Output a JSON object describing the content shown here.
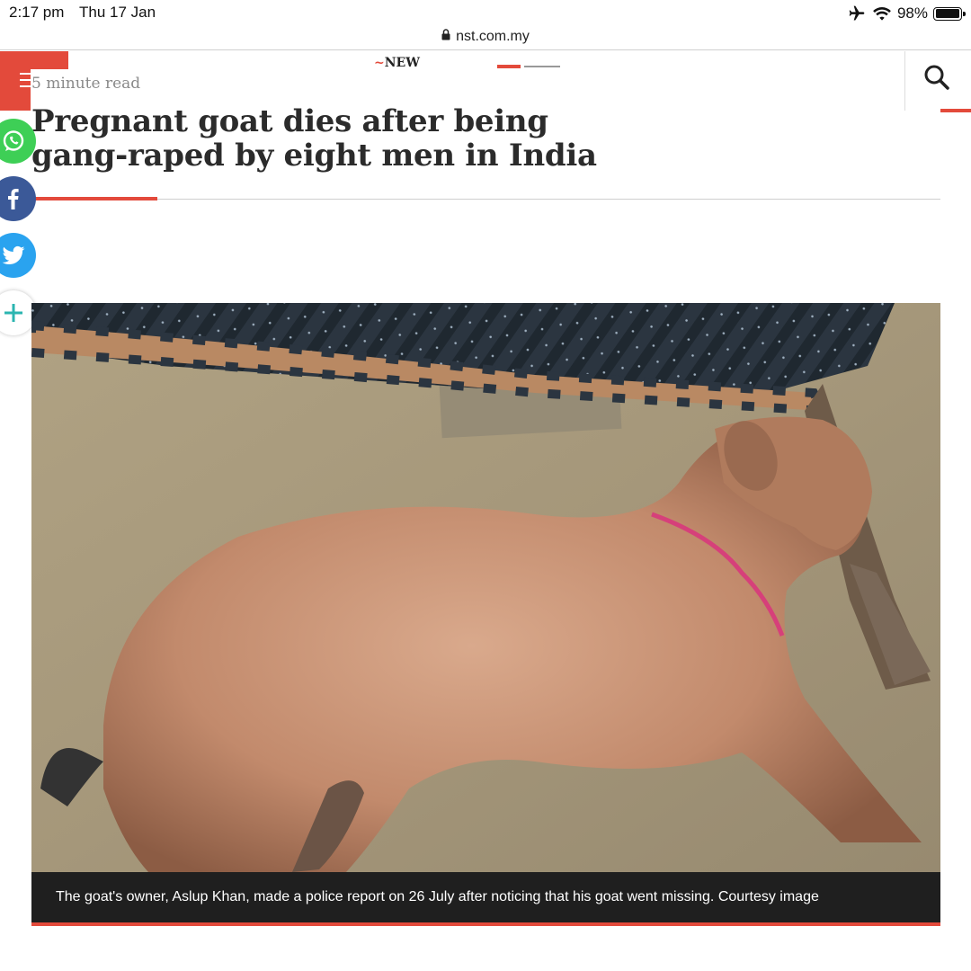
{
  "status_bar": {
    "time": "2:17 pm",
    "date": "Thu 17 Jan",
    "battery": "98%",
    "icons": [
      "airplane-icon",
      "wifi-icon",
      "battery-icon"
    ]
  },
  "browser": {
    "url": "nst.com.my",
    "lock_icon": "lock-icon"
  },
  "site_header": {
    "logo_text": "NEW",
    "menu_icon": "hamburger-icon",
    "search_icon": "search-icon",
    "accent_color": "#e34a3b"
  },
  "article": {
    "read_time": "5 minute read",
    "headline": "Pregnant goat dies after being gang-raped by eight men in India",
    "photo_caption": "The goat's owner, Aslup Khan, made a police report on 26 July after noticing that his goat went missing. Courtesy image"
  },
  "share": {
    "items": [
      {
        "icon": "whatsapp-icon",
        "color": "#3ecf56"
      },
      {
        "icon": "facebook-icon",
        "color": "#3b5998"
      },
      {
        "icon": "twitter-icon",
        "color": "#2aa3ef"
      },
      {
        "icon": "plus-icon",
        "color": "#2bb5b0"
      }
    ]
  }
}
